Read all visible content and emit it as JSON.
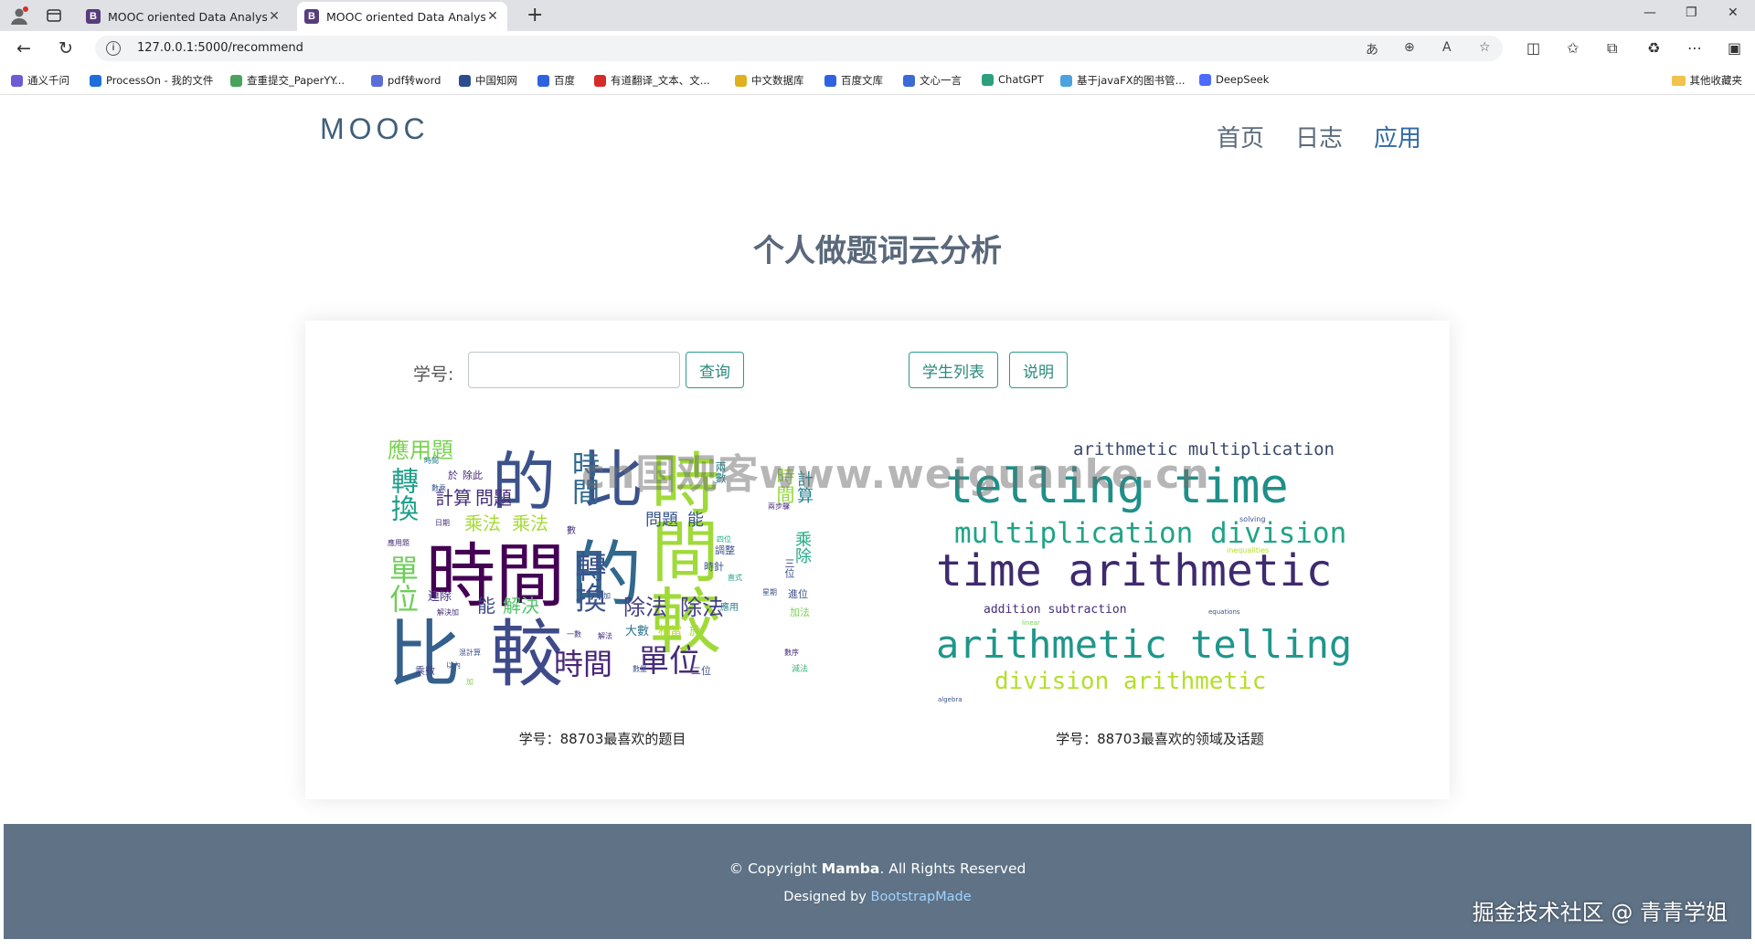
{
  "browser": {
    "tabs": [
      {
        "label": "MOOC oriented Data Analysis Sys",
        "favicon": "B"
      },
      {
        "label": "MOOC oriented Data Analysis Sys",
        "favicon": "B"
      }
    ],
    "new_tab": "+",
    "url": "127.0.0.1:5000/recommend",
    "bookmarks": [
      {
        "label": "通义千问",
        "color": "#6b5bd6"
      },
      {
        "label": "ProcessOn - 我的文件",
        "color": "#1e6fd9"
      },
      {
        "label": "查重提交_PaperYY...",
        "color": "#49a35a"
      },
      {
        "label": "pdf转word",
        "color": "#5a6fd6"
      },
      {
        "label": "中国知网",
        "color": "#2b4d8f"
      },
      {
        "label": "百度",
        "color": "#2f62e0"
      },
      {
        "label": "有道翻译_文本、文...",
        "color": "#d62b2b"
      },
      {
        "label": "中文数据库",
        "color": "#e0b020"
      },
      {
        "label": "百度文库",
        "color": "#2f62e0"
      },
      {
        "label": "文心一言",
        "color": "#3b6ad6"
      },
      {
        "label": "ChatGPT",
        "color": "#2d9f7e"
      },
      {
        "label": "基于javaFX的图书管...",
        "color": "#4aa3df"
      },
      {
        "label": "DeepSeek",
        "color": "#4d6bfe"
      }
    ],
    "other_bookmarks": "其他收藏夹"
  },
  "header": {
    "logo": "MOOC",
    "nav": [
      {
        "label": "首页",
        "active": false
      },
      {
        "label": "日志",
        "active": false
      },
      {
        "label": "应用",
        "active": true
      }
    ]
  },
  "main": {
    "title": "个人做题词云分析",
    "student_id_label": "学号:",
    "student_id_value": "",
    "query_button": "查询",
    "student_list_button": "学生列表",
    "help_button": "说明",
    "left_caption": "学号：88703最喜欢的题目",
    "right_caption": "学号：88703最喜欢的领域及话题",
    "left_cloud_words": [
      {
        "text": "比",
        "color": "#35608d"
      },
      {
        "text": "較",
        "color": "#3e4a89"
      },
      {
        "text": "時間",
        "color": "#440154"
      },
      {
        "text": "的",
        "color": "#31688e"
      },
      {
        "text": "時間",
        "color": "#a0da39"
      },
      {
        "text": "較",
        "color": "#a0da39"
      },
      {
        "text": "的",
        "color": "#3b528b"
      },
      {
        "text": "比",
        "color": "#3b528b"
      },
      {
        "text": "單位",
        "color": "#472c7a"
      },
      {
        "text": "時間",
        "color": "#482677"
      },
      {
        "text": "轉換",
        "color": "#3b528b"
      },
      {
        "text": "時間",
        "color": "#31688e"
      },
      {
        "text": "時間",
        "color": "#95d840"
      },
      {
        "text": "應用題",
        "color": "#7ad151"
      },
      {
        "text": "轉換",
        "color": "#1f9e89"
      },
      {
        "text": "單位",
        "color": "#6ece58"
      },
      {
        "text": "計算",
        "color": "#472d7b"
      },
      {
        "text": "問題",
        "color": "#472d7b"
      },
      {
        "text": "乘法",
        "color": "#a5db36"
      },
      {
        "text": "乘法",
        "color": "#a5db36"
      },
      {
        "text": "除法",
        "color": "#433e85"
      },
      {
        "text": "除法",
        "color": "#433e85"
      },
      {
        "text": "能",
        "color": "#3e4989"
      },
      {
        "text": "解決",
        "color": "#52c569"
      },
      {
        "text": "問題",
        "color": "#39568c"
      },
      {
        "text": "能",
        "color": "#39568c"
      },
      {
        "text": "計算",
        "color": "#26828e"
      },
      {
        "text": "乘除",
        "color": "#22a884"
      },
      {
        "text": "大數",
        "color": "#2c728e"
      },
      {
        "text": "相當",
        "color": "#b5de2b"
      },
      {
        "text": "於",
        "color": "#a5db36"
      },
      {
        "text": "連除",
        "color": "#46327e"
      },
      {
        "text": "乘數",
        "color": "#404688"
      },
      {
        "text": "於",
        "color": "#482475"
      },
      {
        "text": "除此",
        "color": "#482475"
      },
      {
        "text": "時針",
        "color": "#3b528b"
      },
      {
        "text": "調整",
        "color": "#3b528b"
      },
      {
        "text": "進位",
        "color": "#3b528b"
      },
      {
        "text": "加法",
        "color": "#7ad151"
      },
      {
        "text": "兩數",
        "color": "#26828e"
      },
      {
        "text": "日期",
        "color": "#472d7b"
      },
      {
        "text": "數",
        "color": "#472d7b"
      },
      {
        "text": "直式",
        "color": "#1f9e89"
      },
      {
        "text": "三位",
        "color": "#3b528b"
      },
      {
        "text": "減法",
        "color": "#35b779"
      },
      {
        "text": "數序",
        "color": "#482677"
      },
      {
        "text": "以內",
        "color": "#3b528b"
      },
      {
        "text": "兩步驟",
        "color": "#472d7b"
      },
      {
        "text": "二位",
        "color": "#3b528b"
      },
      {
        "text": "應用",
        "color": "#26828e"
      },
      {
        "text": "星期",
        "color": "#3b528b"
      },
      {
        "text": "解決加",
        "color": "#472d7b"
      },
      {
        "text": "數乘",
        "color": "#3b528b"
      },
      {
        "text": "數量",
        "color": "#3b528b"
      },
      {
        "text": "乘加",
        "color": "#3b528b"
      },
      {
        "text": "應用題",
        "color": "#472d7b"
      },
      {
        "text": "四位",
        "color": "#22a884"
      },
      {
        "text": "時間",
        "color": "#26828e"
      },
      {
        "text": "一數",
        "color": "#472d7b"
      },
      {
        "text": "解法",
        "color": "#472d7b"
      },
      {
        "text": "加",
        "color": "#7ad151"
      },
      {
        "text": "混計算",
        "color": "#3b528b"
      }
    ],
    "right_cloud_words": [
      {
        "text": "arithmetic multiplication",
        "color": "#3b4a6b"
      },
      {
        "text": "telling time",
        "color": "#1f8f89"
      },
      {
        "text": "multiplication division",
        "color": "#20a486"
      },
      {
        "text": "time arithmetic",
        "color": "#3f2a6e"
      },
      {
        "text": "addition subtraction",
        "color": "#472d7b"
      },
      {
        "text": "arithmetic telling",
        "color": "#1f968b"
      },
      {
        "text": "division arithmetic",
        "color": "#b5de2b"
      },
      {
        "text": "solving",
        "color": "#3b528b"
      },
      {
        "text": "inequalities",
        "color": "#b5de2b"
      },
      {
        "text": "equations",
        "color": "#3b528b"
      },
      {
        "text": "linear",
        "color": "#7ad151"
      },
      {
        "text": "algebra",
        "color": "#3b528b"
      }
    ]
  },
  "watermark": "cn国观客www.weiguanke.cn",
  "footer": {
    "copyright_prefix": "© Copyright ",
    "copyright_brand": "Mamba",
    "copyright_suffix": ". All Rights Reserved",
    "designed_prefix": "Designed by ",
    "designed_link": "BootstrapMade"
  },
  "credit": "掘金技术社区 @ 青青学姐"
}
